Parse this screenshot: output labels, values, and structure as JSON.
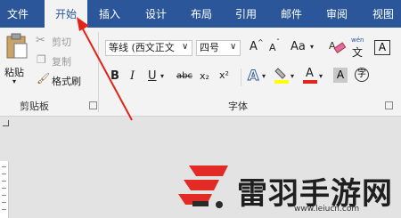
{
  "tabs": [
    {
      "label": "文件",
      "active": false
    },
    {
      "label": "开始",
      "active": true
    },
    {
      "label": "插入",
      "active": false
    },
    {
      "label": "设计",
      "active": false
    },
    {
      "label": "布局",
      "active": false
    },
    {
      "label": "引用",
      "active": false
    },
    {
      "label": "邮件",
      "active": false
    },
    {
      "label": "审阅",
      "active": false
    },
    {
      "label": "视图",
      "active": false
    }
  ],
  "clipboard": {
    "paste_label": "粘贴",
    "cut_label": "剪切",
    "copy_label": "复制",
    "format_painter_label": "格式刷",
    "group_label": "剪贴板"
  },
  "font": {
    "font_name": "等线 (西文正文",
    "font_size": "四号",
    "grow_label": "A",
    "shrink_label": "A",
    "change_case_label": "Aa",
    "phonetic_top": "wén",
    "phonetic_bottom": "文",
    "bold": "B",
    "italic": "I",
    "underline": "U",
    "strikethrough": "abc",
    "subscript": "x₂",
    "superscript": "x²",
    "text_effect": "A",
    "font_color": "A",
    "char_shading": "A",
    "enclosed_char": "字",
    "group_label": "字体"
  },
  "watermark": {
    "title": "雷羽手游网",
    "url": "www.leiucn.com"
  },
  "colors": {
    "accent": "#2b579a",
    "highlight": "#ffff00",
    "font_color": "#e2231a",
    "arrow": "#e2231a",
    "logo_red": "#e22b25"
  }
}
